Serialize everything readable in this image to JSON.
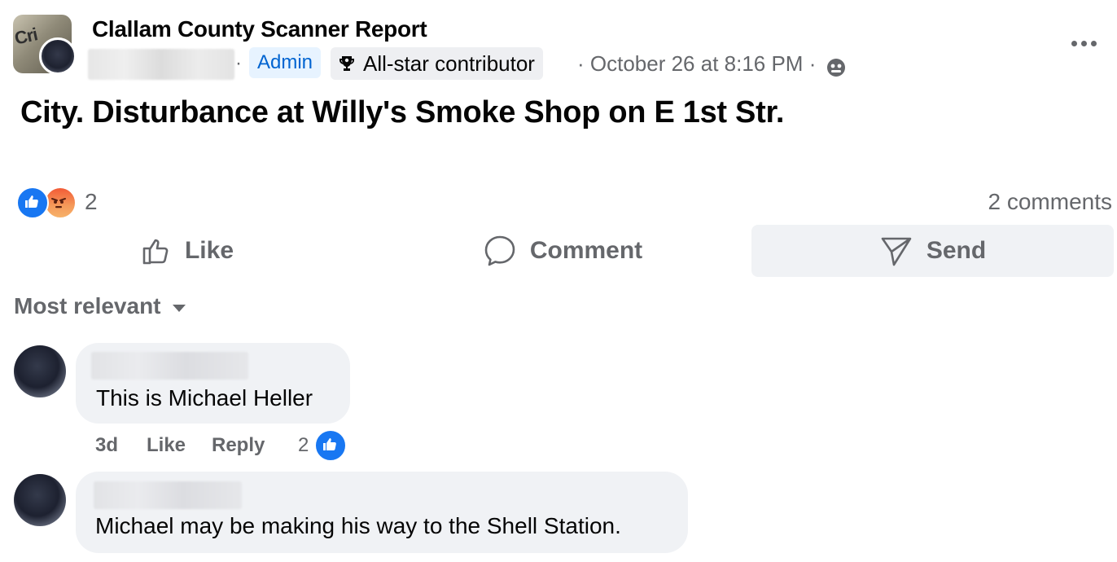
{
  "post": {
    "group_name": "Clallam County Scanner Report",
    "avatar_text": "Cri",
    "admin_badge": "Admin",
    "star_badge": "All-star contributor",
    "separator": "·",
    "date": "· October 26 at 8:16 PM ·",
    "text": "City. Disturbance at Willy's Smoke Shop on E 1st Str.",
    "reaction_count": "2",
    "comments_count": "2 comments"
  },
  "actions": {
    "like": "Like",
    "comment": "Comment",
    "send": "Send"
  },
  "sort_label": "Most relevant",
  "comments": [
    {
      "text": "This is Michael Heller",
      "time": "3d",
      "like_label": "Like",
      "reply_label": "Reply",
      "like_count": "2"
    },
    {
      "text": "Michael may be making his way to the Shell Station."
    }
  ],
  "colors": {
    "accent": "#1877f2",
    "admin_bg": "#e7f3ff",
    "admin_text": "#0064d1",
    "secondary_text": "#65676b",
    "bubble": "#f0f2f5"
  },
  "icons": [
    "trophy-icon",
    "public-icon",
    "more-icon",
    "like-reaction-icon",
    "angry-reaction-icon",
    "thumbs-up-icon",
    "comment-icon",
    "send-icon",
    "chevron-down-icon"
  ]
}
